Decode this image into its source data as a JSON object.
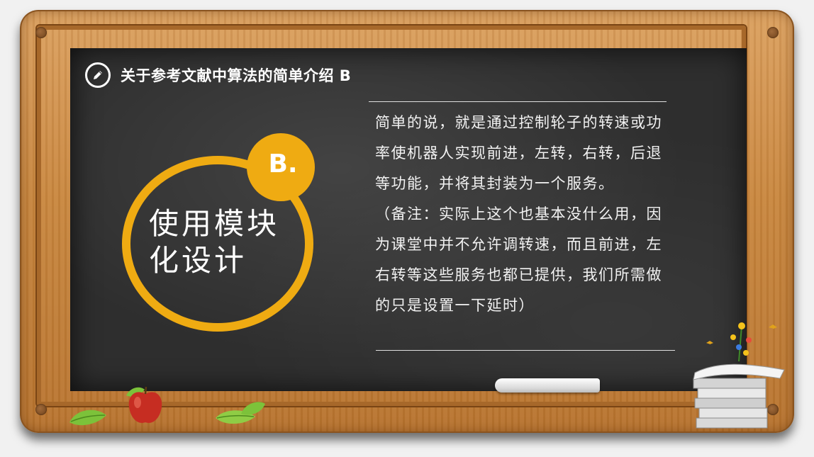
{
  "title": "关于参考文献中算法的简单介绍  B",
  "badge": "B.",
  "circle_title": "使用模块化设计",
  "body": {
    "paragraph1": "简单的说，就是通过控制轮子的转速或功率使机器人实现前进，左转，右转，后退等功能，并将其封装为一个服务。",
    "paragraph2": "（备注：实际上这个也基本没什么用，因为课堂中并不允许调转速，而且前进，左右转等这些服务也都已提供，我们所需做的只是设置一下延时）"
  },
  "icons": {
    "title_icon": "pencil-icon",
    "decorations": [
      "apple-icon",
      "leaf-icon",
      "chalk-icon",
      "books-icon",
      "flowers-icon",
      "butterfly-icon"
    ]
  },
  "colors": {
    "accent": "#efab12",
    "board": "#2e2e2e",
    "frame": "#c9873f",
    "text": "#ffffff"
  }
}
